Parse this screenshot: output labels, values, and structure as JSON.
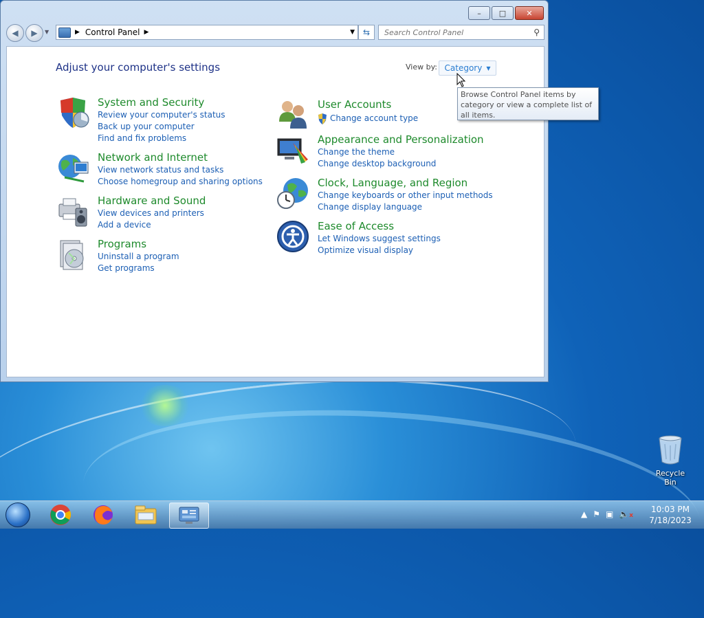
{
  "window": {
    "buttons": {
      "minimize": "–",
      "maximize": "□",
      "close": "✕"
    },
    "breadcrumb": "Control Panel",
    "search_placeholder": "Search Control Panel",
    "heading": "Adjust your computer's settings",
    "view_by_label": "View by:",
    "view_by_value": "Category"
  },
  "categories": [
    {
      "title": "System and Security",
      "links": [
        "Review your computer's status",
        "Back up your computer",
        "Find and fix problems"
      ]
    },
    {
      "title": "Network and Internet",
      "links": [
        "View network status and tasks",
        "Choose homegroup and sharing options"
      ]
    },
    {
      "title": "Hardware and Sound",
      "links": [
        "View devices and printers",
        "Add a device"
      ]
    },
    {
      "title": "Programs",
      "links": [
        "Uninstall a program",
        "Get programs"
      ]
    },
    {
      "title": "User Accounts",
      "links": [
        "Change account type"
      ]
    },
    {
      "title": "Appearance and Personalization",
      "links": [
        "Change the theme",
        "Change desktop background"
      ]
    },
    {
      "title": "Clock, Language, and Region",
      "links": [
        "Change keyboards or other input methods",
        "Change display language"
      ]
    },
    {
      "title": "Ease of Access",
      "links": [
        "Let Windows suggest settings",
        "Optimize visual display"
      ]
    }
  ],
  "tooltip": "Browse Control Panel items by category or view a complete list of all items.",
  "desktop": {
    "recycle_bin": "Recycle Bin"
  },
  "taskbar": {
    "apps": [
      "chrome-icon",
      "firefox-icon",
      "file-explorer-icon",
      "control-panel-icon"
    ],
    "clock_time": "10:03 PM",
    "clock_date": "7/18/2023"
  }
}
